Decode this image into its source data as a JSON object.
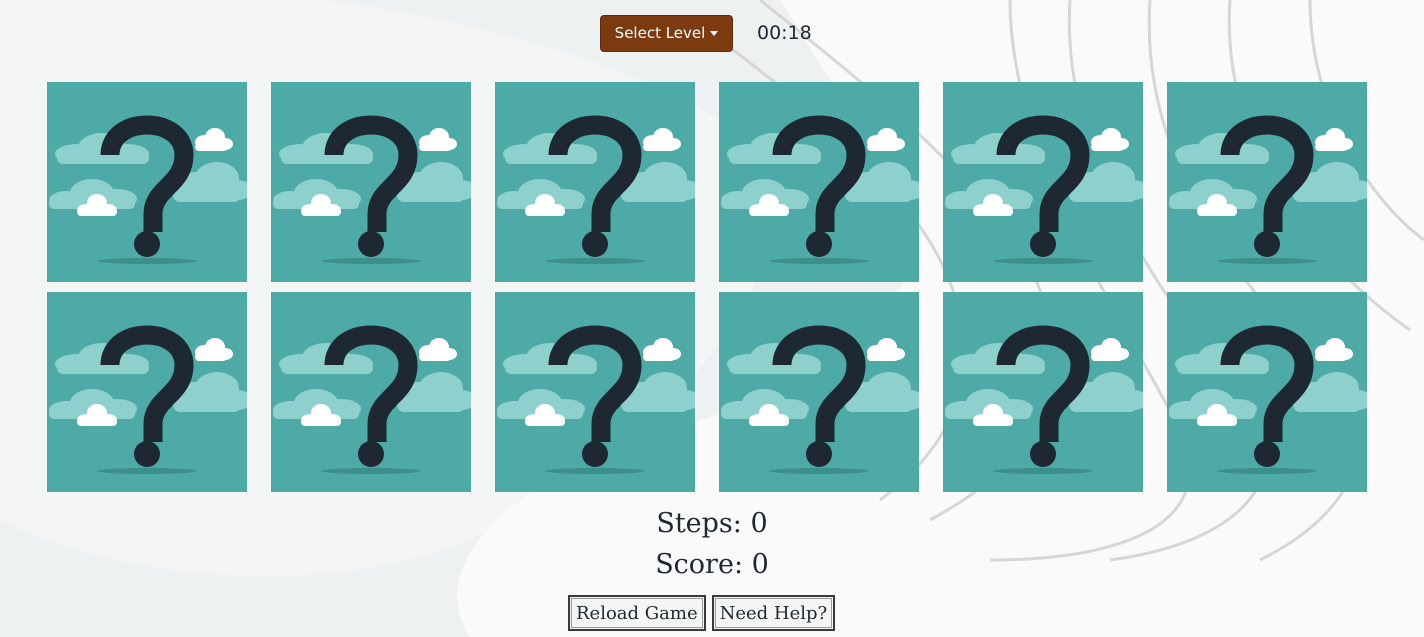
{
  "header": {
    "level_label": "Select Level",
    "timer": "00:18"
  },
  "board": {
    "card_back_icon": "question-mark-icon",
    "card_back_color": "#4eaaa6",
    "cards": [
      {
        "state": "face-down"
      },
      {
        "state": "face-down"
      },
      {
        "state": "face-down"
      },
      {
        "state": "face-down"
      },
      {
        "state": "face-down"
      },
      {
        "state": "face-down"
      },
      {
        "state": "face-down"
      },
      {
        "state": "face-down"
      },
      {
        "state": "face-down"
      },
      {
        "state": "face-down"
      },
      {
        "state": "face-down"
      },
      {
        "state": "face-down"
      }
    ]
  },
  "stats": {
    "steps": "Steps: 0",
    "score": "Score: 0"
  },
  "actions": {
    "reload_label": "Reload Game",
    "help_label": "Need Help?"
  },
  "colors": {
    "level_button": "#7b3a10",
    "text": "#1d2833",
    "page_background": "#f0f2f2"
  }
}
